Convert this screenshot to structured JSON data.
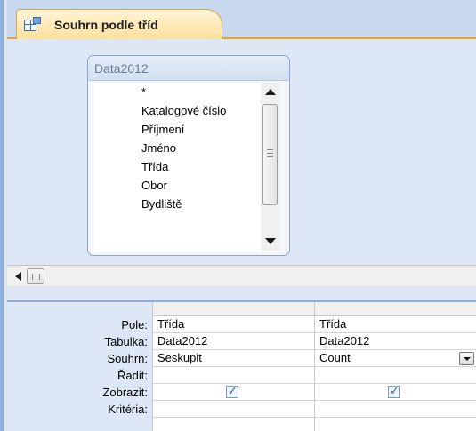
{
  "tab": {
    "title": "Souhrn podle tříd",
    "icon": "query-table-icon"
  },
  "table_box": {
    "title": "Data2012",
    "fields": [
      "*",
      "Katalogové číslo",
      "Příjmení",
      "Jméno",
      "Třída",
      "Obor",
      "Bydliště"
    ]
  },
  "grid": {
    "row_labels": [
      "Pole:",
      "Tabulka:",
      "Souhrn:",
      "Řadit:",
      "Zobrazit:",
      "Kritéria:"
    ],
    "columns": [
      {
        "pole": "Třída",
        "tabulka": "Data2012",
        "souhrn": "Seskupit",
        "radit": "",
        "zobrazit": true,
        "kriteria": ""
      },
      {
        "pole": "Třída",
        "tabulka": "Data2012",
        "souhrn": "Count",
        "radit": "",
        "zobrazit": true,
        "kriteria": ""
      }
    ]
  },
  "colors": {
    "frame": "#8fb0dc",
    "background": "#dde7f5",
    "tab_accent": "#e3a53a"
  }
}
